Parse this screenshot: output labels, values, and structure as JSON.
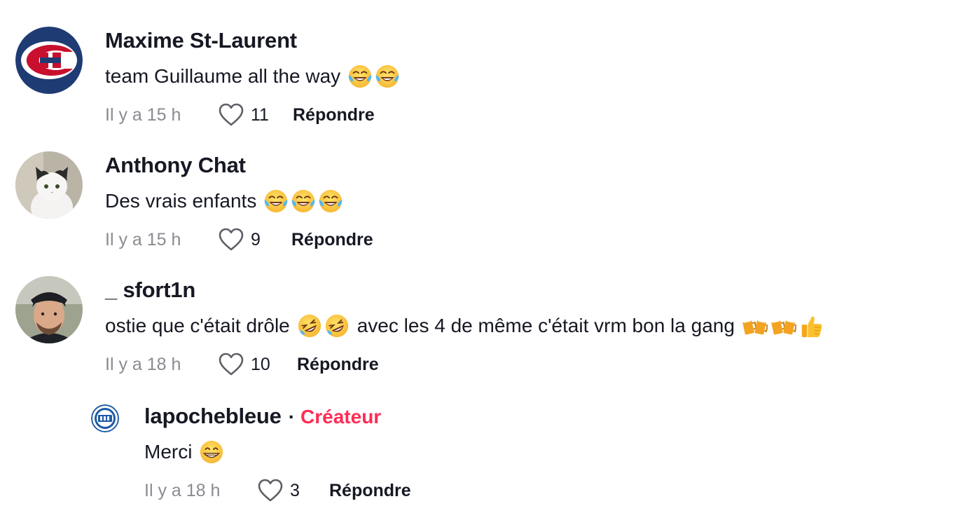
{
  "comments": [
    {
      "username": "Maxime St-Laurent",
      "text": "team Guillaume all the way",
      "emojis": [
        "joy-emoji",
        "joy-emoji"
      ],
      "time": "Il y a 15 h",
      "likes": "11",
      "reply_label": "Répondre"
    },
    {
      "username": "Anthony Chat",
      "text": "Des vrais enfants",
      "emojis": [
        "joy-emoji",
        "joy-emoji",
        "joy-emoji"
      ],
      "time": "Il y a 15 h",
      "likes": "9",
      "reply_label": "Répondre"
    },
    {
      "username": "_ sfort1n",
      "text_before": "ostie que c'était drôle",
      "text_after": "avec les 4 de même c'était vrm bon la gang",
      "emojis_mid": [
        "rofl-emoji",
        "rofl-emoji"
      ],
      "emojis_end": [
        "beers-emoji",
        "beers-emoji",
        "thumbs-up-emoji"
      ],
      "time": "Il y a 18 h",
      "likes": "10",
      "reply_label": "Répondre"
    }
  ],
  "reply": {
    "username": "lapochebleue",
    "separator": "·",
    "badge": "Créateur",
    "text": "Merci",
    "emojis": [
      "grin-emoji"
    ],
    "time": "Il y a 18 h",
    "likes": "3",
    "reply_label": "Répondre"
  },
  "colors": {
    "text": "#161823",
    "muted": "#8a8b91",
    "creator": "#fe2c55",
    "heart_outline": "#5e5f66"
  }
}
